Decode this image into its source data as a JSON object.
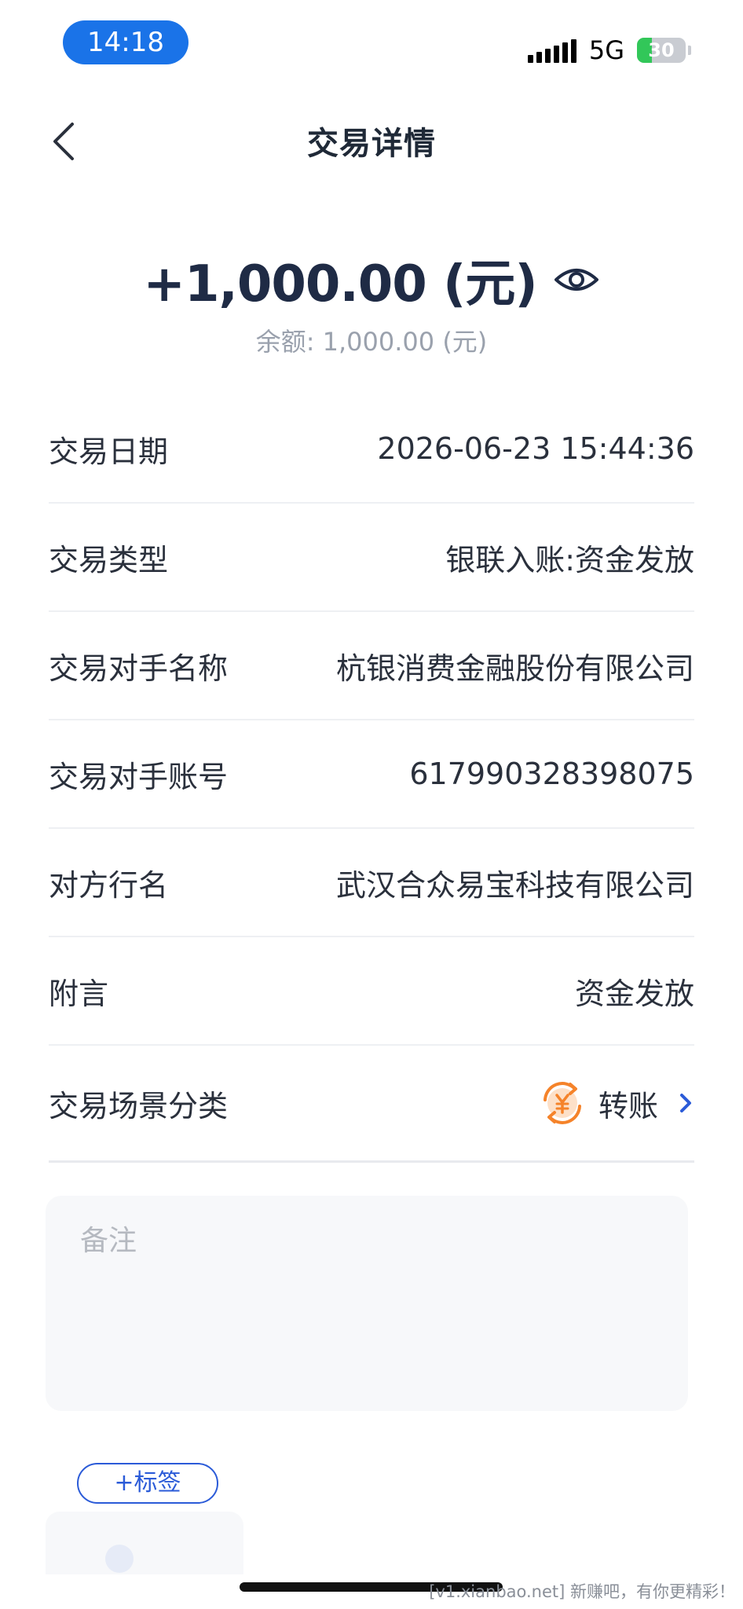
{
  "status_bar": {
    "time": "14:18",
    "network": "5G",
    "battery": "30"
  },
  "header": {
    "title": "交易详情"
  },
  "amount": {
    "value": "+1,000.00 (元)",
    "balance": "余额: 1,000.00 (元)"
  },
  "details": [
    {
      "label": "交易日期",
      "value": "2026-06-23 15:44:36"
    },
    {
      "label": "交易类型",
      "value": "银联入账:资金发放"
    },
    {
      "label": "交易对手名称",
      "value": "杭银消费金融股份有限公司"
    },
    {
      "label": "交易对手账号",
      "value": "617990328398075"
    },
    {
      "label": "对方行名",
      "value": "武汉合众易宝科技有限公司"
    },
    {
      "label": "附言",
      "value": "资金发放"
    }
  ],
  "scene": {
    "label": "交易场景分类",
    "value": "转账",
    "icon": "yuan-transfer-icon"
  },
  "remark": {
    "placeholder": "备注"
  },
  "tag": {
    "label": "+标签"
  },
  "watermark": "[v1.xianbao.net] 新赚吧，有你更精彩！",
  "colors": {
    "accent": "#2b5bd8",
    "time_pill": "#1a73e8",
    "battery": "#32c759",
    "scene_icon": "#f5832a"
  }
}
